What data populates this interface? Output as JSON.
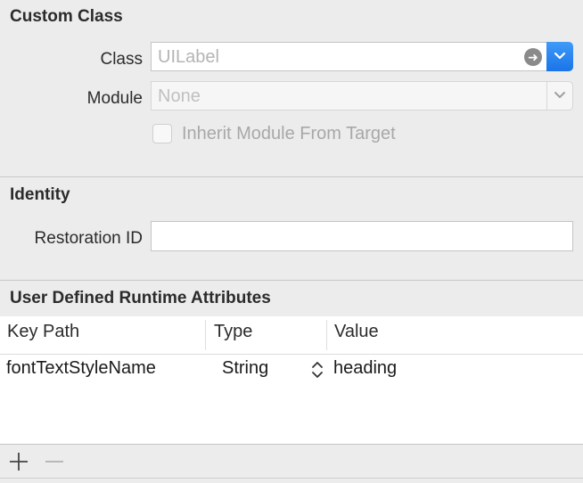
{
  "custom_class": {
    "title": "Custom Class",
    "class_label": "Class",
    "class_placeholder": "UILabel",
    "module_label": "Module",
    "module_placeholder": "None",
    "inherit_label": "Inherit Module From Target"
  },
  "identity": {
    "title": "Identity",
    "restoration_id_label": "Restoration ID",
    "restoration_id_value": ""
  },
  "runtime_attributes": {
    "title": "User Defined Runtime Attributes",
    "columns": [
      "Key Path",
      "Type",
      "Value"
    ],
    "rows": [
      {
        "key_path": "fontTextStyleName",
        "type": "String",
        "value": "heading"
      }
    ]
  },
  "colors": {
    "accent": "#1a74e8",
    "panel_bg": "#ececec"
  },
  "icons": {
    "class_go": "arrow-right-circle-icon",
    "dropdown": "chevron-down-icon",
    "type_stepper": "up-down-chevron-icon",
    "add": "plus-icon",
    "remove": "minus-icon"
  }
}
